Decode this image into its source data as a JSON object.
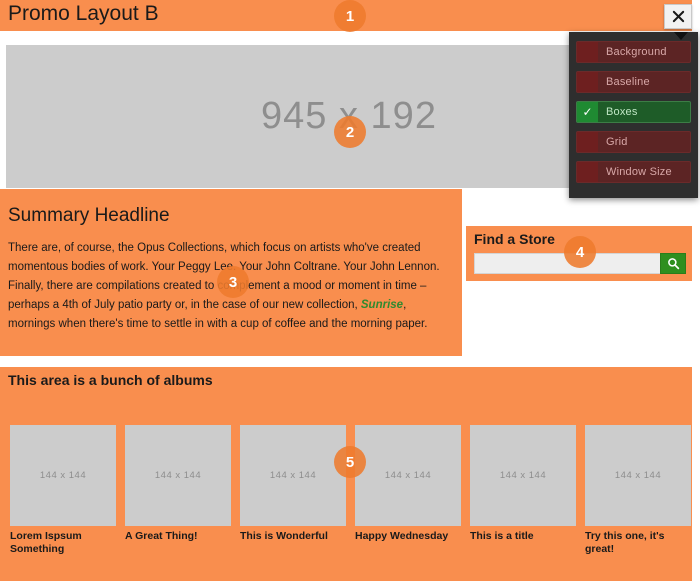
{
  "page": {
    "title": "Promo Layout B",
    "colors": {
      "accent_orange": "#f98e4e",
      "badge_orange": "#ee7b2e",
      "placeholder_gray": "#cccccc",
      "green_button": "#2f8f1f",
      "link_green": "#2f8a2f",
      "panel_dark": "#2e2e2e",
      "panel_row_off": "#5c2424",
      "panel_row_on": "#1e5c28"
    }
  },
  "hero": {
    "placeholder_label": "945 x 192"
  },
  "summary": {
    "headline": "Summary Headline",
    "body_part1": "There are, of course, the Opus Collections, which focus on artists who've created momentous bodies of work. Your Peggy Lee. Your John Coltrane. Your John Lennon. Finally, there are compilations created to complement a mood or moment in time – perhaps a 4th of July patio party or, in the case of our new collection, ",
    "body_highlight": "Sunrise",
    "body_part2": ", mornings when there's time to settle in with a cup of coffee and the morning paper."
  },
  "find_store": {
    "title": "Find a Store",
    "input_value": "",
    "input_placeholder": "",
    "search_icon": "search-icon"
  },
  "albums": {
    "section_title": "This area is a bunch of albums",
    "items": [
      {
        "thumb_label": "144 x 144",
        "caption": "Lorem Ispsum Something"
      },
      {
        "thumb_label": "144 x 144",
        "caption": "A Great Thing!"
      },
      {
        "thumb_label": "144 x 144",
        "caption": "This is Wonderful"
      },
      {
        "thumb_label": "144 x 144",
        "caption": "Happy Wednesday"
      },
      {
        "thumb_label": "144 x 144",
        "caption": "This is a title"
      },
      {
        "thumb_label": "144 x 144",
        "caption": "Try this one, it's great!"
      }
    ]
  },
  "badges": [
    {
      "number": "1"
    },
    {
      "number": "2"
    },
    {
      "number": "3"
    },
    {
      "number": "4"
    },
    {
      "number": "5"
    }
  ],
  "close_button": {
    "icon": "close-icon",
    "label": "✕"
  },
  "dev_panel": {
    "rows": [
      {
        "label": "Background",
        "enabled": false,
        "check": ""
      },
      {
        "label": "Baseline",
        "enabled": false,
        "check": ""
      },
      {
        "label": "Boxes",
        "enabled": true,
        "check": "✓"
      },
      {
        "label": "Grid",
        "enabled": false,
        "check": ""
      },
      {
        "label": "Window Size",
        "enabled": false,
        "check": ""
      }
    ]
  }
}
